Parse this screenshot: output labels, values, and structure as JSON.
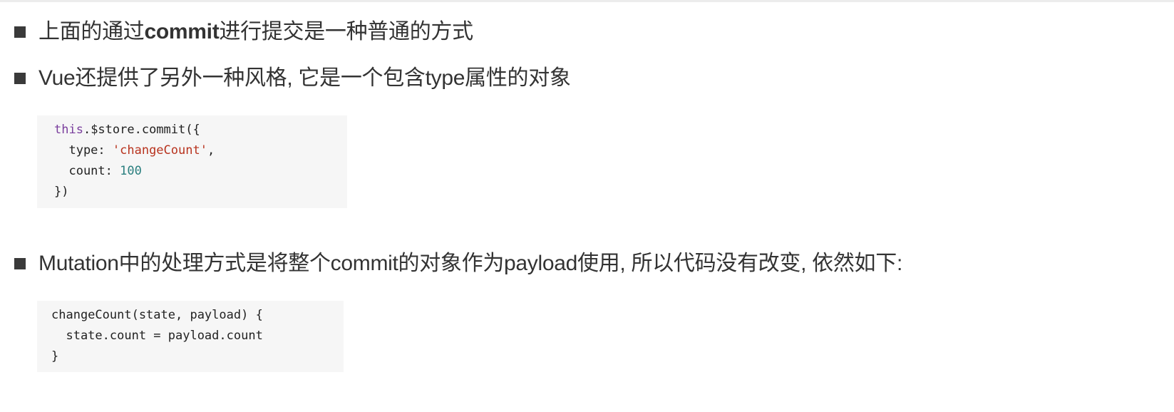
{
  "bullets": [
    {
      "parts": [
        "上面的通过",
        "commit",
        "进行提交是一种普通的方式"
      ]
    },
    {
      "text": "Vue还提供了另外一种风格, 它是一个包含type属性的对象"
    },
    {
      "text": "Mutation中的处理方式是将整个commit的对象作为payload使用, 所以代码没有改变, 依然如下:"
    }
  ],
  "code1": {
    "line1_kw": "this",
    "line1_rest": ".$store.commit({",
    "line2_key": "  type: ",
    "line2_str": "'changeCount'",
    "line2_end": ",",
    "line3_key": "  count: ",
    "line3_num": "100",
    "line4": "})"
  },
  "code2": {
    "line1": "changeCount(state, payload) {",
    "line2": "  state.count = payload.count",
    "line3": "}"
  }
}
